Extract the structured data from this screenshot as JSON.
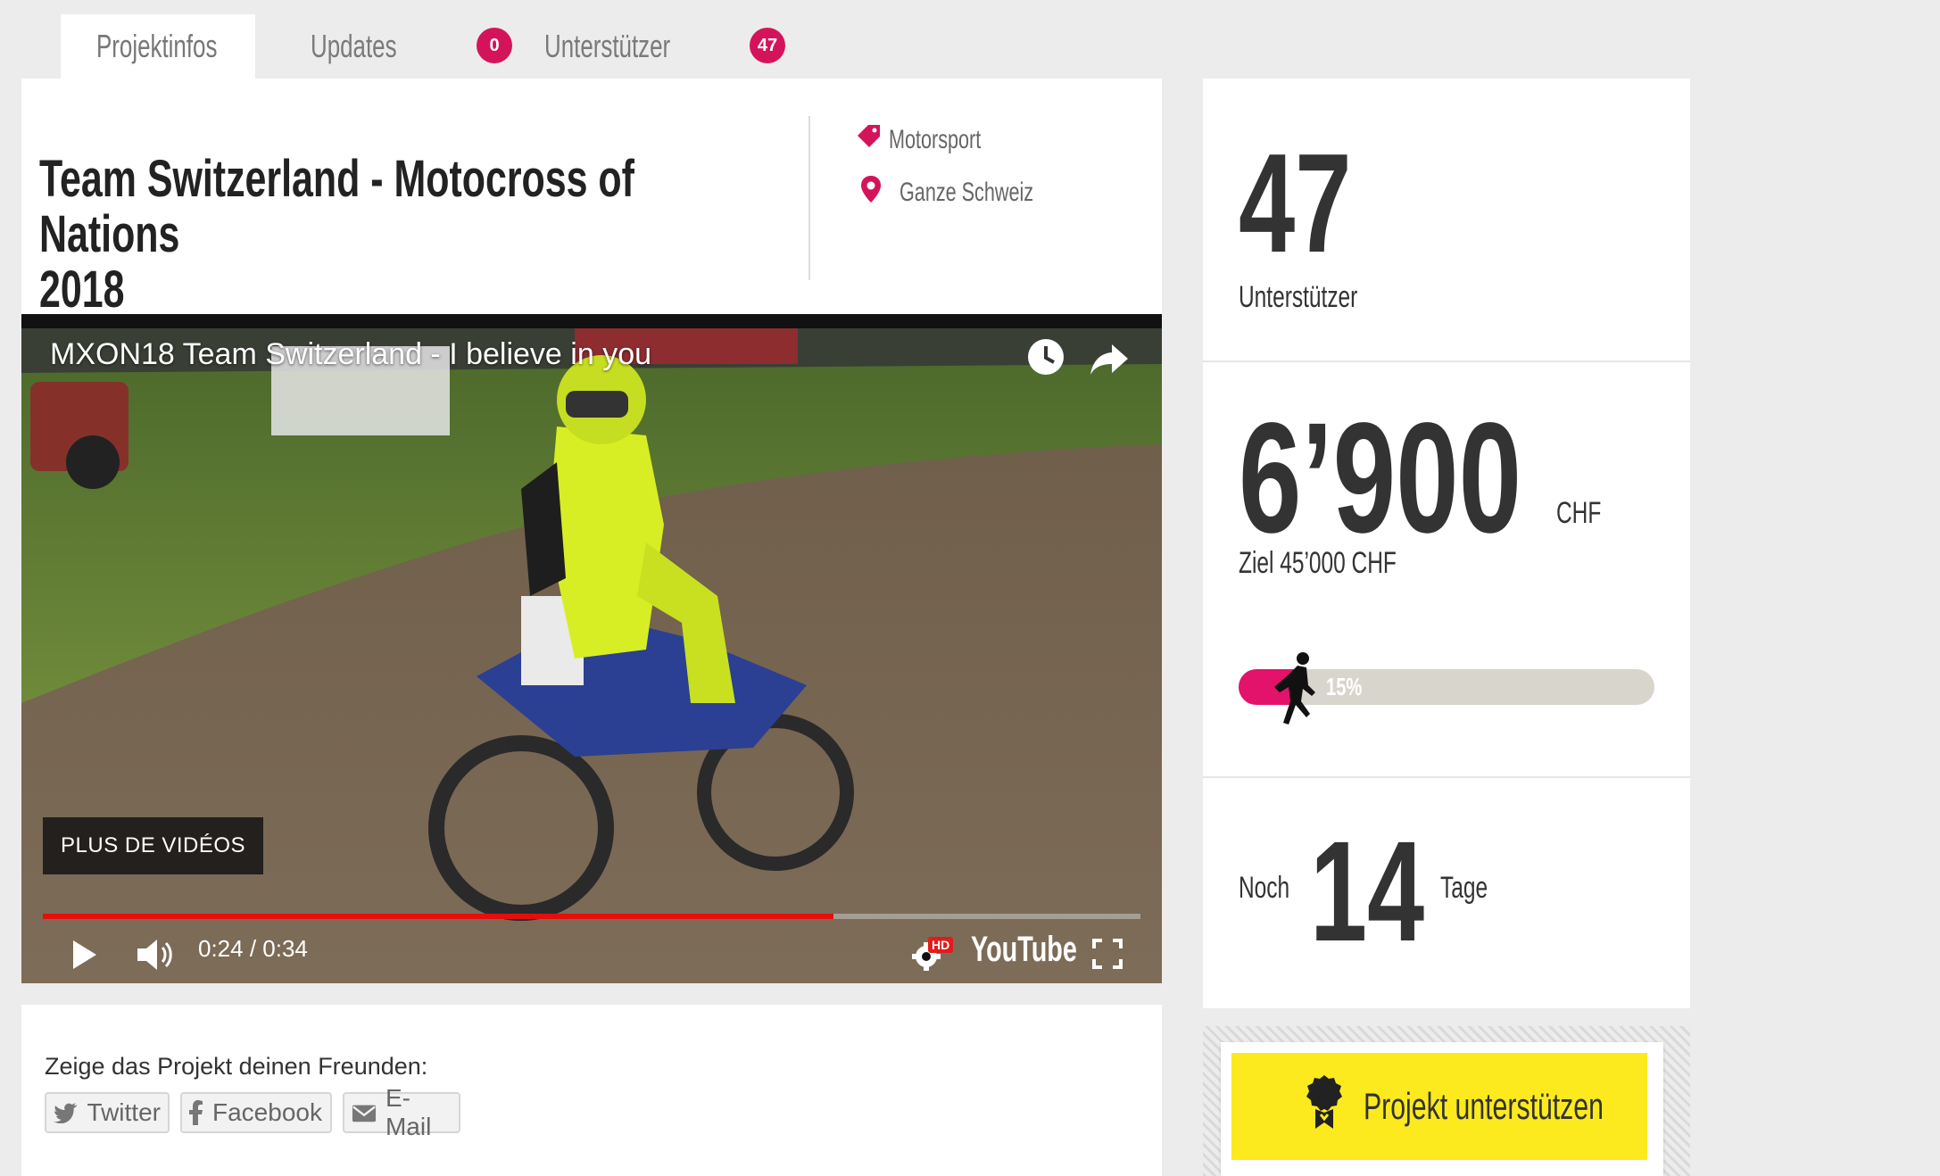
{
  "tabs": [
    {
      "label": "Projektinfos",
      "badge": null
    },
    {
      "label": "Updates",
      "badge": "0"
    },
    {
      "label": "Unterstützer",
      "badge": "47"
    }
  ],
  "project": {
    "title_line1": "Team Switzerland - Motocross of Nations",
    "title_line2": "2018",
    "category": "Motorsport",
    "location": "Ganze Schweiz"
  },
  "video": {
    "title": "MXON18 Team Switzerland - I believe in you",
    "more_videos": "PLUS DE VIDÉOS",
    "time": "0:24 / 0:34",
    "progress_fraction": 0.72,
    "hd_badge": "HD",
    "logo_text": "YouTube",
    "icons": [
      "watch-later-icon",
      "share-icon",
      "play-icon",
      "volume-icon",
      "settings-icon",
      "fullscreen-icon"
    ]
  },
  "share": {
    "label": "Zeige das Projekt deinen Freunden:",
    "buttons": [
      "Twitter",
      "Facebook",
      "E-Mail"
    ]
  },
  "stats": {
    "supporters_count": "47",
    "supporters_label": "Unterstützer",
    "amount": "6’900",
    "currency": "CHF",
    "goal": "Ziel 45’000 CHF",
    "percent_label": "15%",
    "percent_value": 15,
    "days_prefix": "Noch",
    "days_count": "14",
    "days_suffix": "Tage"
  },
  "cta": {
    "label": "Projekt unterstützen"
  },
  "colors": {
    "accent": "#d4145a",
    "cta_yellow": "#fcea1e",
    "progress_red": "#e40e0e"
  }
}
